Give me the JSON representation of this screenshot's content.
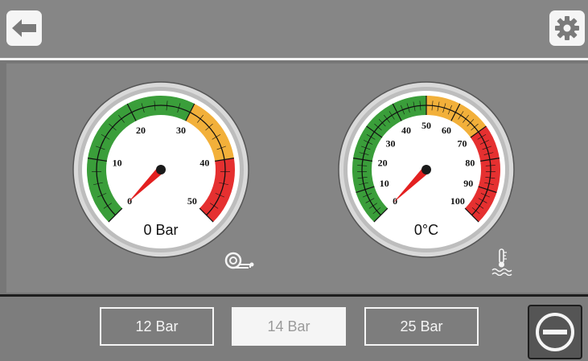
{
  "header": {
    "back_icon": "arrow-left-icon",
    "settings_icon": "gear-icon"
  },
  "gauges": [
    {
      "id": "pressure",
      "value": 0,
      "value_label": "0 Bar",
      "min": 0,
      "max": 50,
      "ticks": [
        "0",
        "10",
        "20",
        "30",
        "40",
        "50"
      ],
      "zones": [
        {
          "from": 0,
          "to": 30,
          "color": "#3a9e3a"
        },
        {
          "from": 30,
          "to": 40,
          "color": "#f2b03a"
        },
        {
          "from": 40,
          "to": 50,
          "color": "#e53030"
        }
      ],
      "icon": "air-hose-icon"
    },
    {
      "id": "temperature",
      "value": 0,
      "value_label": "0°C",
      "min": 0,
      "max": 100,
      "ticks": [
        "0",
        "10",
        "20",
        "30",
        "40",
        "50",
        "60",
        "70",
        "80",
        "90",
        "100"
      ],
      "zones": [
        {
          "from": 0,
          "to": 50,
          "color": "#3a9e3a"
        },
        {
          "from": 50,
          "to": 70,
          "color": "#f2b03a"
        },
        {
          "from": 70,
          "to": 100,
          "color": "#e53030"
        }
      ],
      "icon": "coolant-temperature-icon"
    }
  ],
  "presets": [
    {
      "label": "12 Bar",
      "active": false
    },
    {
      "label": "14 Bar",
      "active": true
    },
    {
      "label": "25 Bar",
      "active": false
    }
  ],
  "stop_icon": "stop-circle-icon"
}
